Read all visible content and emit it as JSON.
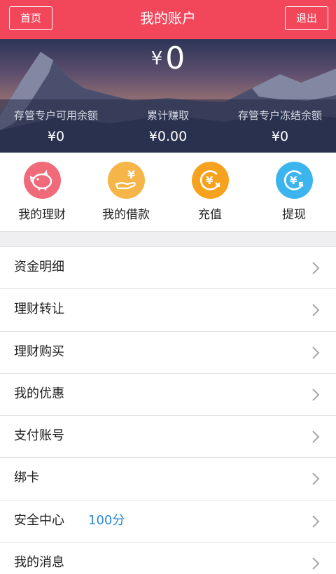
{
  "header": {
    "title": "我的账户",
    "home_label": "首页",
    "logout_label": "退出"
  },
  "summary": {
    "currency": "¥",
    "total": "0",
    "stats": [
      {
        "label": "存管专户可用余额",
        "value": "¥0"
      },
      {
        "label": "累计赚取",
        "value": "¥0.00"
      },
      {
        "label": "存管专户冻结余额",
        "value": "¥0"
      }
    ]
  },
  "quick_actions": [
    {
      "label": "我的理财",
      "icon": "piggy-bank-icon",
      "color": "#f06a7a"
    },
    {
      "label": "我的借款",
      "icon": "hand-yen-icon",
      "color": "#f5b548"
    },
    {
      "label": "充值",
      "icon": "recharge-yen-icon",
      "color": "#f7a21e"
    },
    {
      "label": "提现",
      "icon": "withdraw-yen-icon",
      "color": "#3cb4ee"
    }
  ],
  "menu": [
    {
      "label": "资金明细"
    },
    {
      "label": "理财转让"
    },
    {
      "label": "理财购买"
    },
    {
      "label": "我的优惠"
    },
    {
      "label": "支付账号"
    },
    {
      "label": "绑卡"
    },
    {
      "label": "安全中心",
      "extra": "100分"
    },
    {
      "label": "我的消息"
    }
  ],
  "colors": {
    "brand": "#f2475a",
    "link": "#2b8ad8"
  }
}
